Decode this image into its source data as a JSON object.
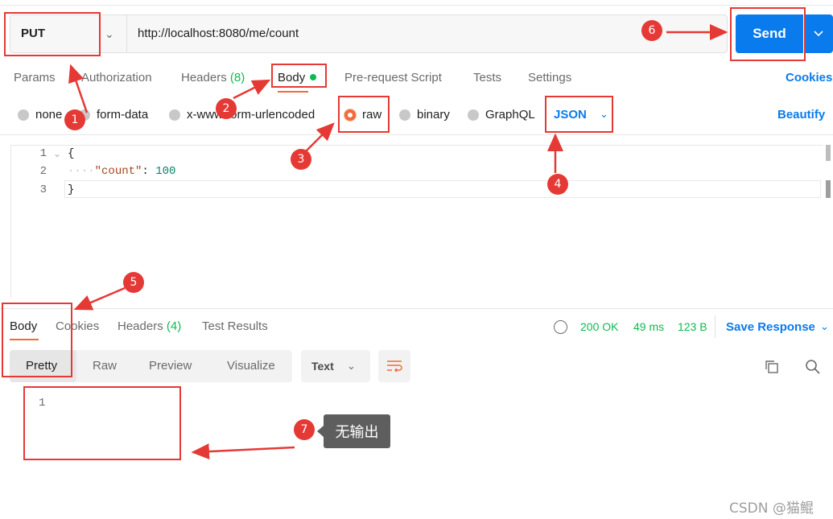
{
  "request": {
    "method": "PUT",
    "url": "http://localhost:8080/me/count",
    "send_label": "Send"
  },
  "request_tabs": {
    "params": "Params",
    "authorization": "Authorization",
    "headers": "Headers",
    "headers_count": "(8)",
    "body": "Body",
    "prerequest": "Pre-request Script",
    "tests": "Tests",
    "settings": "Settings",
    "cookies": "Cookies"
  },
  "body_types": {
    "none": "none",
    "form_data": "form-data",
    "urlencoded": "x-www-form-urlencoded",
    "raw": "raw",
    "binary": "binary",
    "graphql": "GraphQL",
    "format": "JSON",
    "beautify": "Beautify"
  },
  "editor": {
    "line_numbers": [
      "1",
      "2",
      "3"
    ],
    "open_brace": "{",
    "indent": "····",
    "key": "\"count\"",
    "colon": ": ",
    "value": "100",
    "close_brace": "}"
  },
  "response": {
    "tabs": {
      "body": "Body",
      "cookies": "Cookies",
      "headers": "Headers",
      "headers_count": "(4)",
      "test_results": "Test Results"
    },
    "status": "200 OK",
    "time": "49 ms",
    "size": "123 B",
    "save_response": "Save Response",
    "views": {
      "pretty": "Pretty",
      "raw": "Raw",
      "preview": "Preview",
      "visualize": "Visualize"
    },
    "format": "Text",
    "line_number": "1"
  },
  "annotations": {
    "badges": [
      "1",
      "2",
      "3",
      "4",
      "5",
      "6",
      "7"
    ],
    "note": "无输出",
    "accent_color": "#e53935"
  },
  "watermark": "CSDN @猫鲲",
  "colors": {
    "brand_blue": "#097bed",
    "accent_orange": "#f26b3a",
    "success_green": "#0cbb52"
  }
}
